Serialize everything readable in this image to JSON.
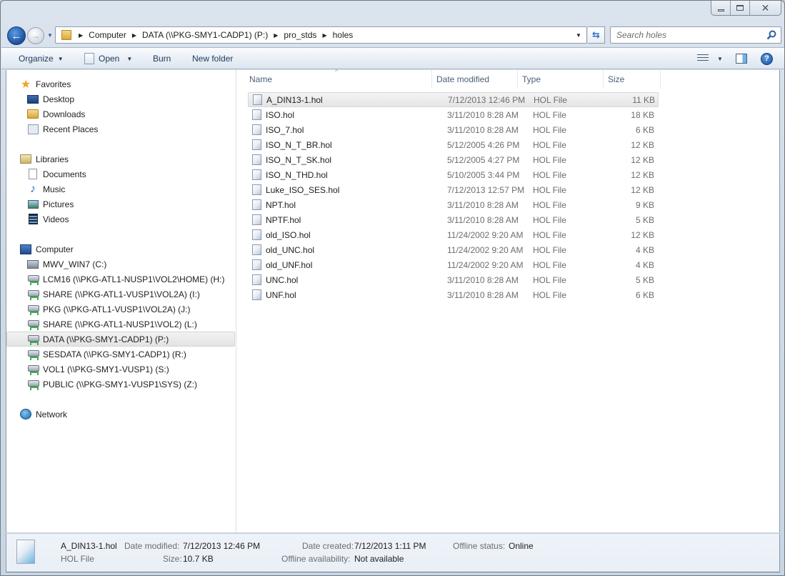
{
  "window": {
    "caption_buttons": [
      "minimize",
      "maximize",
      "close"
    ]
  },
  "navigation": {
    "breadcrumb": [
      "Computer",
      "DATA (\\\\PKG-SMY1-CADP1) (P:)",
      "pro_stds",
      "holes"
    ],
    "search_placeholder": "Search holes"
  },
  "toolbar": {
    "organize_label": "Organize",
    "open_label": "Open",
    "burn_label": "Burn",
    "new_folder_label": "New folder"
  },
  "sidebar": {
    "favorites": {
      "label": "Favorites",
      "items": [
        {
          "label": "Desktop",
          "icon": "desktop-icon"
        },
        {
          "label": "Downloads",
          "icon": "downloads-icon"
        },
        {
          "label": "Recent Places",
          "icon": "recent-places-icon"
        }
      ]
    },
    "libraries": {
      "label": "Libraries",
      "items": [
        {
          "label": "Documents",
          "icon": "documents-icon"
        },
        {
          "label": "Music",
          "icon": "music-icon"
        },
        {
          "label": "Pictures",
          "icon": "pictures-icon"
        },
        {
          "label": "Videos",
          "icon": "videos-icon"
        }
      ]
    },
    "computer": {
      "label": "Computer",
      "items": [
        {
          "label": "MWV_WIN7 (C:)",
          "icon": "local-drive-icon"
        },
        {
          "label": "LCM16 (\\\\PKG-ATL1-NUSP1\\VOL2\\HOME) (H:)",
          "icon": "network-drive-icon"
        },
        {
          "label": "SHARE (\\\\PKG-ATL1-VUSP1\\VOL2A) (I:)",
          "icon": "network-drive-icon"
        },
        {
          "label": "PKG (\\\\PKG-ATL1-VUSP1\\VOL2A) (J:)",
          "icon": "network-drive-icon"
        },
        {
          "label": "SHARE (\\\\PKG-ATL1-NUSP1\\VOL2) (L:)",
          "icon": "network-drive-icon"
        },
        {
          "label": "DATA (\\\\PKG-SMY1-CADP1) (P:)",
          "icon": "network-drive-icon",
          "selected": true
        },
        {
          "label": "SESDATA (\\\\PKG-SMY1-CADP1) (R:)",
          "icon": "network-drive-icon"
        },
        {
          "label": "VOL1 (\\\\PKG-SMY1-VUSP1) (S:)",
          "icon": "network-drive-icon"
        },
        {
          "label": "PUBLIC (\\\\PKG-SMY1-VUSP1\\SYS) (Z:)",
          "icon": "network-drive-icon"
        }
      ]
    },
    "network": {
      "label": "Network"
    }
  },
  "file_list": {
    "columns": [
      "Name",
      "Date modified",
      "Type",
      "Size"
    ],
    "rows": [
      {
        "name": "A_DIN13-1.hol",
        "date": "7/12/2013 12:46 PM",
        "type": "HOL File",
        "size": "11 KB",
        "selected": true
      },
      {
        "name": "ISO.hol",
        "date": "3/11/2010 8:28 AM",
        "type": "HOL File",
        "size": "18 KB"
      },
      {
        "name": "ISO_7.hol",
        "date": "3/11/2010 8:28 AM",
        "type": "HOL File",
        "size": "6 KB"
      },
      {
        "name": "ISO_N_T_BR.hol",
        "date": "5/12/2005 4:26 PM",
        "type": "HOL File",
        "size": "12 KB"
      },
      {
        "name": "ISO_N_T_SK.hol",
        "date": "5/12/2005 4:27 PM",
        "type": "HOL File",
        "size": "12 KB"
      },
      {
        "name": "ISO_N_THD.hol",
        "date": "5/10/2005 3:44 PM",
        "type": "HOL File",
        "size": "12 KB"
      },
      {
        "name": "Luke_ISO_SES.hol",
        "date": "7/12/2013 12:57 PM",
        "type": "HOL File",
        "size": "12 KB"
      },
      {
        "name": "NPT.hol",
        "date": "3/11/2010 8:28 AM",
        "type": "HOL File",
        "size": "9 KB"
      },
      {
        "name": "NPTF.hol",
        "date": "3/11/2010 8:28 AM",
        "type": "HOL File",
        "size": "5 KB"
      },
      {
        "name": "old_ISO.hol",
        "date": "11/24/2002 9:20 AM",
        "type": "HOL File",
        "size": "12 KB"
      },
      {
        "name": "old_UNC.hol",
        "date": "11/24/2002 9:20 AM",
        "type": "HOL File",
        "size": "4 KB"
      },
      {
        "name": "old_UNF.hol",
        "date": "11/24/2002 9:20 AM",
        "type": "HOL File",
        "size": "4 KB"
      },
      {
        "name": "UNC.hol",
        "date": "3/11/2010 8:28 AM",
        "type": "HOL File",
        "size": "5 KB"
      },
      {
        "name": "UNF.hol",
        "date": "3/11/2010 8:28 AM",
        "type": "HOL File",
        "size": "6 KB"
      }
    ]
  },
  "details_pane": {
    "file_name": "A_DIN13-1.hol",
    "file_type": "HOL File",
    "date_modified_label": "Date modified:",
    "date_modified": "7/12/2013 12:46 PM",
    "size_label": "Size:",
    "size": "10.7 KB",
    "date_created_label": "Date created:",
    "date_created": "7/12/2013 1:11 PM",
    "offline_availability_label": "Offline availability:",
    "offline_availability": "Not available",
    "offline_status_label": "Offline status:",
    "offline_status": "Online"
  }
}
